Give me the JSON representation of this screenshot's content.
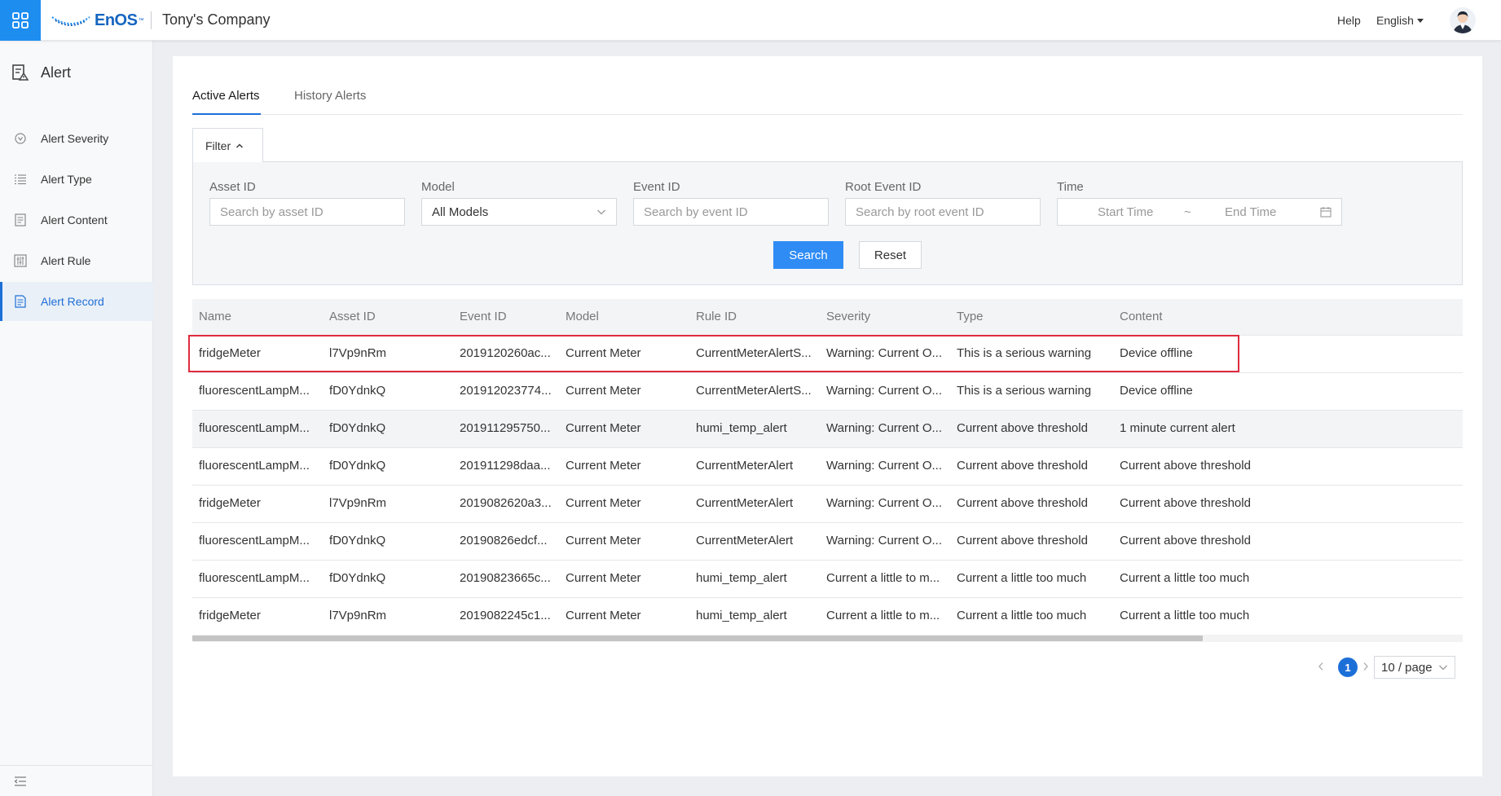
{
  "topbar": {
    "logo_text": "EnOS",
    "logo_tm": "™",
    "company": "Tony's Company",
    "help": "Help",
    "language": "English"
  },
  "sidebar": {
    "title": "Alert",
    "items": [
      {
        "label": "Alert Severity",
        "icon": "severity-icon"
      },
      {
        "label": "Alert Type",
        "icon": "list-icon"
      },
      {
        "label": "Alert Content",
        "icon": "document-icon"
      },
      {
        "label": "Alert Rule",
        "icon": "rule-icon"
      },
      {
        "label": "Alert Record",
        "icon": "record-icon",
        "active": true
      }
    ]
  },
  "tabs": [
    {
      "label": "Active Alerts",
      "active": true
    },
    {
      "label": "History Alerts",
      "active": false
    }
  ],
  "filter": {
    "toggle_label": "Filter",
    "asset_id": {
      "label": "Asset ID",
      "placeholder": "Search by asset ID"
    },
    "model": {
      "label": "Model",
      "value": "All Models"
    },
    "event_id": {
      "label": "Event ID",
      "placeholder": "Search by event ID"
    },
    "root_event_id": {
      "label": "Root Event ID",
      "placeholder": "Search by root event ID"
    },
    "time": {
      "label": "Time",
      "start_placeholder": "Start Time",
      "separator": "~",
      "end_placeholder": "End Time"
    },
    "search_button": "Search",
    "reset_button": "Reset"
  },
  "table": {
    "columns": [
      "Name",
      "Asset ID",
      "Event ID",
      "Model",
      "Rule ID",
      "Severity",
      "Type",
      "Content"
    ],
    "rows": [
      [
        "fridgeMeter",
        "l7Vp9nRm",
        "2019120260ac...",
        "Current Meter",
        "CurrentMeterAlertS...",
        "Warning: Current O...",
        "This is a serious warning",
        "Device offline"
      ],
      [
        "fluorescentLampM...",
        "fD0YdnkQ",
        "201912023774...",
        "Current Meter",
        "CurrentMeterAlertS...",
        "Warning: Current O...",
        "This is a serious warning",
        "Device offline"
      ],
      [
        "fluorescentLampM...",
        "fD0YdnkQ",
        "201911295750...",
        "Current Meter",
        "humi_temp_alert",
        "Warning: Current O...",
        "Current above threshold",
        "1 minute current alert"
      ],
      [
        "fluorescentLampM...",
        "fD0YdnkQ",
        "201911298daa...",
        "Current Meter",
        "CurrentMeterAlert",
        "Warning: Current O...",
        "Current above threshold",
        "Current above threshold"
      ],
      [
        "fridgeMeter",
        "l7Vp9nRm",
        "2019082620a3...",
        "Current Meter",
        "CurrentMeterAlert",
        "Warning: Current O...",
        "Current above threshold",
        "Current above threshold"
      ],
      [
        "fluorescentLampM...",
        "fD0YdnkQ",
        "20190826edcf...",
        "Current Meter",
        "CurrentMeterAlert",
        "Warning: Current O...",
        "Current above threshold",
        "Current above threshold"
      ],
      [
        "fluorescentLampM...",
        "fD0YdnkQ",
        "20190823665c...",
        "Current Meter",
        "humi_temp_alert",
        "Current a little to m...",
        "Current a little too much",
        "Current a little too much"
      ],
      [
        "fridgeMeter",
        "l7Vp9nRm",
        "2019082245c1...",
        "Current Meter",
        "humi_temp_alert",
        "Current a little to m...",
        "Current a little too much",
        "Current a little too much"
      ]
    ],
    "highlighted_row": 0,
    "highlight_color": "#e02b40"
  },
  "pagination": {
    "current_page": "1",
    "page_size": "10 / page"
  },
  "colors": {
    "accent": "#1d6fd8",
    "primary_button": "#2f8cf5",
    "app_grid": "#1d8df0"
  }
}
